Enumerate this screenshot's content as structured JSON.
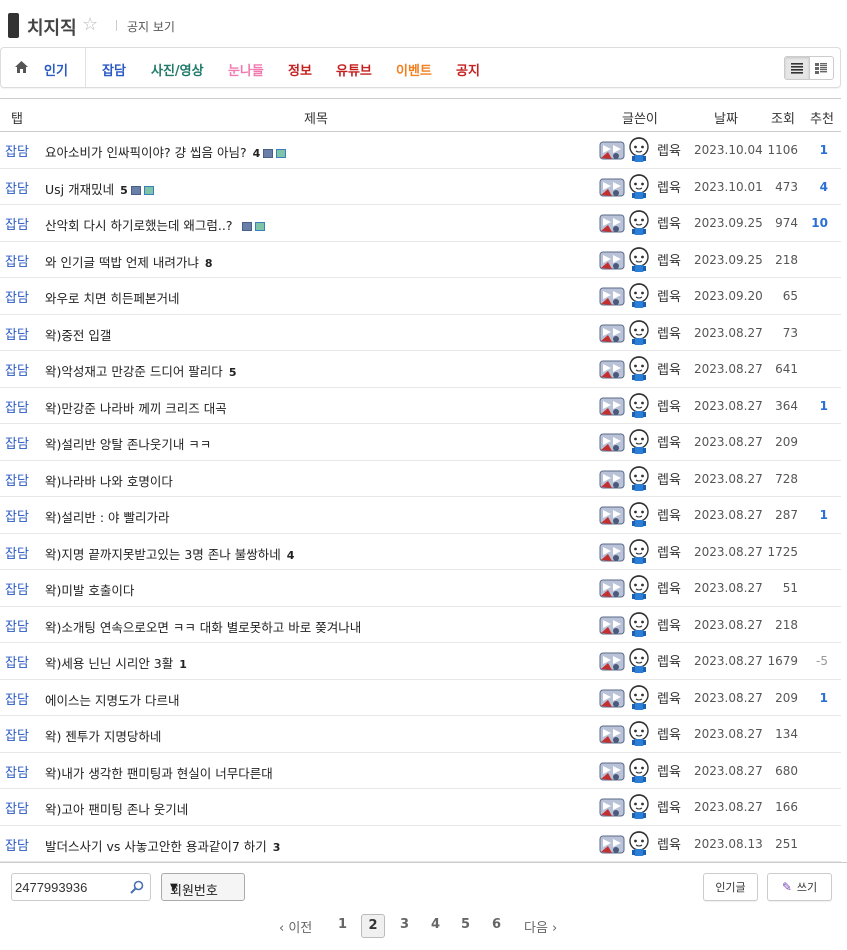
{
  "header": {
    "title": "치지직",
    "notice_link": "공지 보기"
  },
  "tabs": [
    {
      "label": "인기",
      "color": "#2a5ac2",
      "left": 0
    },
    {
      "label": "잡담",
      "color": "#2a5ac2"
    },
    {
      "label": "사진/영상",
      "color": "#1f7a6a"
    },
    {
      "label": "눈나들",
      "color": "#f07ab0"
    },
    {
      "label": "정보",
      "color": "#c42020"
    },
    {
      "label": "유튜브",
      "color": "#c42020"
    },
    {
      "label": "이벤트",
      "color": "#f08020"
    },
    {
      "label": "공지",
      "color": "#c42020"
    }
  ],
  "table_header": {
    "tab": "탭",
    "subject": "제목",
    "writer": "글쓴이",
    "date": "날짜",
    "views": "조회",
    "recommend": "추천"
  },
  "rows": [
    {
      "category": "잡담",
      "subject": "요아소비가 인싸픽이야? 걍 씹음 아님?",
      "comments": "4",
      "icons": [
        "disk",
        "pic"
      ],
      "writer": "렙육",
      "date": "2023.10.04",
      "views": "1106",
      "recommend": "1"
    },
    {
      "category": "잡담",
      "subject": "Usj 개재밌네",
      "comments": "5",
      "icons": [
        "disk",
        "pic"
      ],
      "writer": "렙육",
      "date": "2023.10.01",
      "views": "473",
      "recommend": "4"
    },
    {
      "category": "잡담",
      "subject": "산악회 다시 하기로했는데 왜그럼..?",
      "comments": "",
      "icons": [
        "disk",
        "pic"
      ],
      "writer": "렙육",
      "date": "2023.09.25",
      "views": "974",
      "recommend": "10"
    },
    {
      "category": "잡담",
      "subject": "와 인기글 떡밥 언제 내려가냐",
      "comments": "8",
      "icons": [],
      "writer": "렙육",
      "date": "2023.09.25",
      "views": "218",
      "recommend": ""
    },
    {
      "category": "잡담",
      "subject": "와우로 치면 히든페본거네",
      "comments": "",
      "icons": [],
      "writer": "렙육",
      "date": "2023.09.20",
      "views": "65",
      "recommend": ""
    },
    {
      "category": "잡담",
      "subject": "왁)중전 입갤",
      "comments": "",
      "icons": [],
      "writer": "렙육",
      "date": "2023.08.27",
      "views": "73",
      "recommend": ""
    },
    {
      "category": "잡담",
      "subject": "왁)악성재고 만강준 드디어 팔리다",
      "comments": "5",
      "icons": [],
      "writer": "렙육",
      "date": "2023.08.27",
      "views": "641",
      "recommend": ""
    },
    {
      "category": "잡담",
      "subject": "왁)만강준 나라바 께끼 크리즈 대곡",
      "comments": "",
      "icons": [],
      "writer": "렙육",
      "date": "2023.08.27",
      "views": "364",
      "recommend": "1"
    },
    {
      "category": "잡담",
      "subject": "왁)설리반 앙탈 존나웃기내 ㅋㅋ",
      "comments": "",
      "icons": [],
      "writer": "렙육",
      "date": "2023.08.27",
      "views": "209",
      "recommend": ""
    },
    {
      "category": "잡담",
      "subject": "왁)나라바 나와 호명이다",
      "comments": "",
      "icons": [],
      "writer": "렙육",
      "date": "2023.08.27",
      "views": "728",
      "recommend": ""
    },
    {
      "category": "잡담",
      "subject": "왁)설리반 : 야 빨리가라",
      "comments": "",
      "icons": [],
      "writer": "렙육",
      "date": "2023.08.27",
      "views": "287",
      "recommend": "1"
    },
    {
      "category": "잡담",
      "subject": "왁)지명 끝까지못받고있는 3명 존나 불쌍하네",
      "comments": "4",
      "icons": [],
      "writer": "렙육",
      "date": "2023.08.27",
      "views": "1725",
      "recommend": ""
    },
    {
      "category": "잡담",
      "subject": "왁)미발 호출이다",
      "comments": "",
      "icons": [],
      "writer": "렙육",
      "date": "2023.08.27",
      "views": "51",
      "recommend": ""
    },
    {
      "category": "잡담",
      "subject": "왁)소개팅 연속으로오면 ㅋㅋ 대화 별로못하고 바로 쫒겨나내",
      "comments": "",
      "icons": [],
      "writer": "렙육",
      "date": "2023.08.27",
      "views": "218",
      "recommend": ""
    },
    {
      "category": "잡담",
      "subject": "왁)세용 닌닌 시리안 3활",
      "comments": "1",
      "icons": [],
      "writer": "렙육",
      "date": "2023.08.27",
      "views": "1679",
      "recommend": "-5"
    },
    {
      "category": "잡담",
      "subject": "에이스는 지명도가 다르내",
      "comments": "",
      "icons": [],
      "writer": "렙육",
      "date": "2023.08.27",
      "views": "209",
      "recommend": "1"
    },
    {
      "category": "잡담",
      "subject": "왁) 젠투가 지명당하네",
      "comments": "",
      "icons": [],
      "writer": "렙육",
      "date": "2023.08.27",
      "views": "134",
      "recommend": ""
    },
    {
      "category": "잡담",
      "subject": "왁)내가 생각한 팬미팅과 현실이 너무다른대",
      "comments": "",
      "icons": [],
      "writer": "렙육",
      "date": "2023.08.27",
      "views": "680",
      "recommend": ""
    },
    {
      "category": "잡담",
      "subject": "왁)고아 팬미팅 존나 웃기네",
      "comments": "",
      "icons": [],
      "writer": "렙육",
      "date": "2023.08.27",
      "views": "166",
      "recommend": ""
    },
    {
      "category": "잡담",
      "subject": "발더스사기 vs 사놓고안한 용과같이7 하기",
      "comments": "3",
      "icons": [],
      "writer": "렙육",
      "date": "2023.08.13",
      "views": "251",
      "recommend": ""
    }
  ],
  "search": {
    "value": "2477993936",
    "select_value": "회원번호"
  },
  "buttons": {
    "popular": "인기글",
    "write": "쓰기"
  },
  "pagination": {
    "prev": "‹ 이전",
    "next": "다음 ›",
    "pages": [
      "1",
      "2",
      "3",
      "4",
      "5",
      "6"
    ],
    "current": "2"
  }
}
